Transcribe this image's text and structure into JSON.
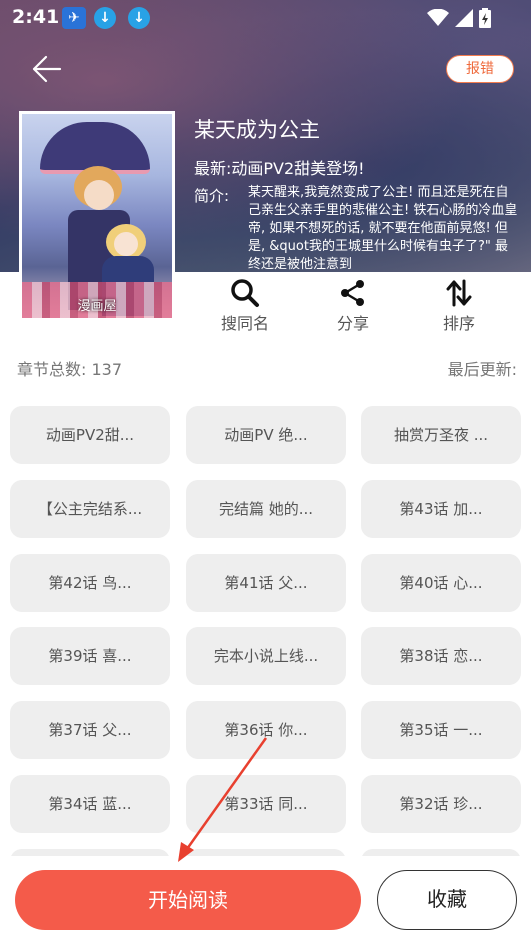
{
  "status_bar": {
    "time": "2:41",
    "app_icon": "bird-app-icon",
    "download_icon": "download-icon"
  },
  "header": {
    "back_icon": "arrow-left-icon",
    "report_label": "报错"
  },
  "book": {
    "title": "某天成为公主",
    "latest_prefix": "最新:",
    "latest_value": "动画PV2甜美登场!",
    "intro_label": "简介:",
    "intro_text": "某天醒来,我竟然变成了公主! 而且还是死在自己亲生父亲手里的悲催公主! 铁石心肠的冷血皇帝, 如果不想死的话, 就不要在他面前晃悠! 但是, &quot我的王城里什么时候有虫子了?\" 最终还是被他注意到",
    "cover_watermark": "漫画屋"
  },
  "actions": [
    {
      "label": "搜同名",
      "icon": "search-icon"
    },
    {
      "label": "分享",
      "icon": "share-icon"
    },
    {
      "label": "排序",
      "icon": "sort-icon"
    }
  ],
  "chapters_info": {
    "total": "章节总数: 137",
    "last_update": "最后更新:"
  },
  "chapters": [
    "动画PV2甜...",
    "动画PV 绝...",
    "抽赏万圣夜 ...",
    "【公主完结系...",
    "完结篇 她的...",
    "第43话 加...",
    "第42话 鸟...",
    "第41话 父...",
    "第40话 心...",
    "第39话 喜...",
    "完本小说上线...",
    "第38话 恋...",
    "第37话 父...",
    "第36话 你...",
    "第35话 一...",
    "第34话 蓝...",
    "第33话 同...",
    "第32话 珍...",
    "",
    "",
    ""
  ],
  "bottom": {
    "start_label": "开始阅读",
    "favorite_label": "收藏"
  },
  "colors": {
    "accent": "#f45b4a",
    "report_border": "#f47c4e",
    "chip_bg": "#eeeeee"
  }
}
